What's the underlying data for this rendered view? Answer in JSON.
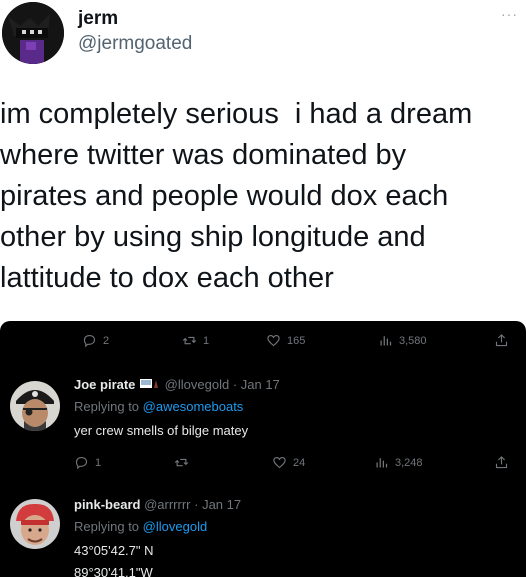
{
  "tweet": {
    "name": "jerm",
    "handle": "@jermgoated",
    "more": "···",
    "text": "im completely serious  i had a dream\nwhere twitter was dominated by\npirates and people would dox each\nother by using ship longitude and\nlattitude to dox each other"
  },
  "parent_actions": {
    "replies": "2",
    "retweets": "1",
    "likes": "165",
    "views": "3,580"
  },
  "reply1": {
    "name": "Joe pirate",
    "handle": "@llovegold",
    "date": "· Jan 17",
    "replying_prefix": "Replying to",
    "replying_to": "@awesomeboats",
    "text": "yer crew smells of bilge matey",
    "actions": {
      "replies": "1",
      "retweets": "",
      "likes": "24",
      "views": "3,248"
    }
  },
  "reply2": {
    "name": "pink-beard",
    "handle": "@arrrrrr",
    "date": "· Jan 17",
    "replying_prefix": "Replying to",
    "replying_to": "@llovegold",
    "line1": "43°05'42.7\" N",
    "line2": "89°30'41.1\"W"
  },
  "colors": {
    "dark_bg": "#000000",
    "link_blue": "#1d9bf0",
    "muted_gray": "#71767b"
  }
}
